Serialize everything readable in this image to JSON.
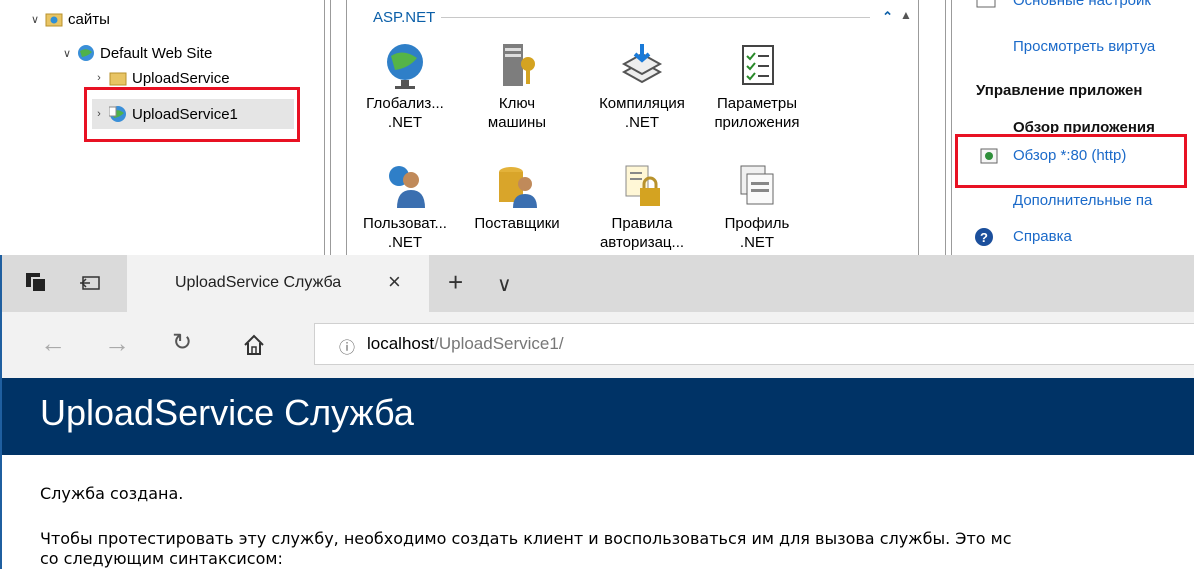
{
  "iis": {
    "tree": {
      "sites_label": "сайты",
      "default_site_label": "Default Web Site",
      "upload_service_label": "UploadService",
      "upload_service1_label": "UploadService1"
    },
    "features": {
      "group_title": "ASP.NET",
      "tiles": [
        {
          "line1": "Глобализ...",
          "line2": ".NET"
        },
        {
          "line1": "Ключ",
          "line2": "машины"
        },
        {
          "line1": "Компиляция",
          "line2": ".NET"
        },
        {
          "line1": "Параметры",
          "line2": "приложения"
        },
        {
          "line1": "Пользоват...",
          "line2": ".NET"
        },
        {
          "line1": "Поставщики",
          "line2": ""
        },
        {
          "line1": "Правила",
          "line2": "авторизац..."
        },
        {
          "line1": "Профиль",
          "line2": ".NET"
        }
      ]
    },
    "actions": {
      "top_link": "Основные настройк",
      "view_virtual": "Просмотреть виртуа",
      "manage_app_heading": "Управление приложен",
      "browse_app_heading": "Обзор приложения",
      "browse_80": "Обзор *:80 (http)",
      "advanced": "Дополнительные па",
      "help": "Справка"
    }
  },
  "browser": {
    "tab_title": "UploadService Служба",
    "address_host": "localhost",
    "address_path": "/UploadService1/",
    "page": {
      "heading": "UploadService Служба",
      "line1": "Служба создана.",
      "line2": "Чтобы протестировать эту службу, необходимо создать клиент и воспользоваться им для вызова службы. Это мс",
      "line3": "со следующим синтаксисом:"
    }
  },
  "colors": {
    "highlight_box": "#e81123",
    "page_banner": "#003366",
    "link_blue": "#1b6ac9"
  }
}
